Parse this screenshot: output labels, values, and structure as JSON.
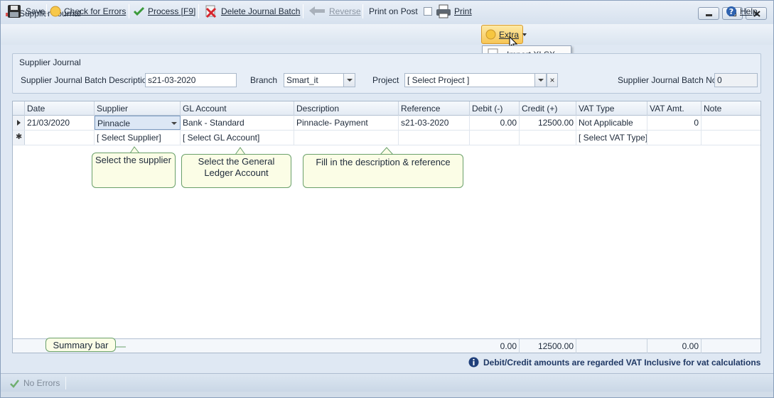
{
  "window": {
    "title": "Supplier Journal"
  },
  "toolbar": {
    "save": "Save",
    "check_errors": "Check for Errors",
    "process": "Process [F9]",
    "delete_batch": "Delete Journal Batch",
    "reverse": "Reverse",
    "print_on_post": "Print on Post",
    "print": "Print",
    "extra": "Extra",
    "help": "Help"
  },
  "extra_menu": {
    "items": [
      {
        "label": "Import XLSX"
      }
    ]
  },
  "batch": {
    "group_title": "Supplier Journal",
    "description_label": "Supplier Journal Batch Description:",
    "description_value": "s21-03-2020",
    "branch_label": "Branch",
    "branch_value": "Smart_it",
    "project_label": "Project",
    "project_value": "[ Select Project ]",
    "project_clear": "×",
    "batch_no_label": "Supplier Journal Batch No.",
    "batch_no_value": "0"
  },
  "grid": {
    "columns": [
      "Date",
      "Supplier",
      "GL Account",
      "Description",
      "Reference",
      "Debit (-)",
      "Credit (+)",
      "VAT Type",
      "VAT Amt.",
      "Note"
    ],
    "rows": [
      {
        "date": "21/03/2020",
        "supplier": "Pinnacle",
        "gl_account": "Bank - Standard",
        "description": "Pinnacle- Payment",
        "reference": "s21-03-2020",
        "debit": "0.00",
        "credit": "12500.00",
        "vat_type": "Not Applicable",
        "vat_amt": "0",
        "note": ""
      }
    ],
    "new_row": {
      "supplier": "[ Select Supplier]",
      "gl_account": "[ Select GL Account]",
      "vat_type": "[ Select VAT Type]"
    },
    "summary": {
      "debit": "0.00",
      "credit": "12500.00",
      "vat_amt": "0.00"
    }
  },
  "callouts": {
    "supplier": "Select the supplier",
    "gl_account": "Select the General Ledger Account",
    "description": "Fill in the description & reference",
    "summary": "Summary bar"
  },
  "info": {
    "text": "Debit/Credit amounts are regarded VAT Inclusive for vat calculations"
  },
  "status": {
    "errors": "No Errors"
  },
  "colors": {
    "accent": "#f7c655",
    "info_text": "#1f3864",
    "callout_border": "#6aa06a",
    "callout_bg": "#fbfde6"
  }
}
